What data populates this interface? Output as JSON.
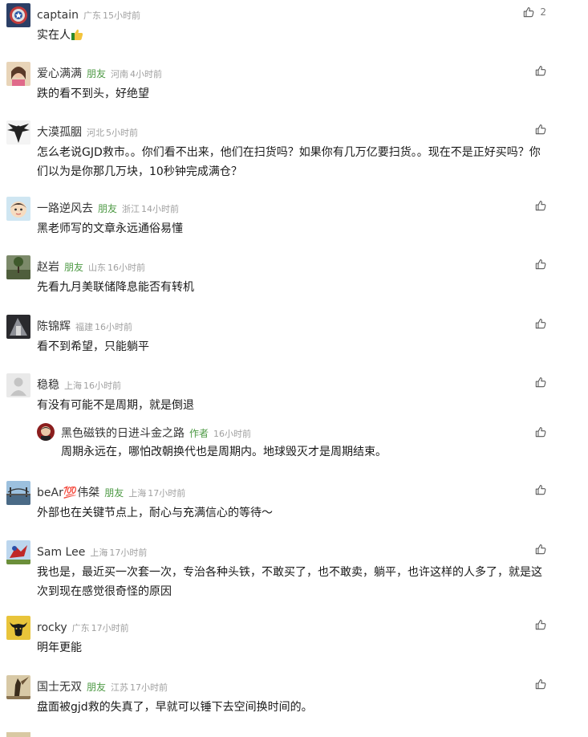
{
  "comments": [
    {
      "name": "captain",
      "friend": "",
      "location": "广东",
      "time": "15小时前",
      "content": "实在人",
      "likes": "2",
      "avatar": "shield-avatar"
    },
    {
      "name": "爱心满满",
      "friend": "朋友",
      "location": "河南",
      "time": "4小时前",
      "content": "跌的看不到头，好绝望",
      "likes": "",
      "avatar": "girl-avatar"
    },
    {
      "name": "大漠孤胭",
      "friend": "",
      "location": "河北",
      "time": "5小时前",
      "content": "怎么老说GJD救市。。你们看不出来，他们在扫货吗？如果你有几万亿要扫货。。现在不是正好买吗？你们以为是你那几万块，10秒钟完成满仓？",
      "likes": "",
      "avatar": "eagle-avatar"
    },
    {
      "name": "一路逆风去",
      "friend": "朋友",
      "location": "浙江",
      "time": "14小时前",
      "content": "黑老师写的文章永远通俗易懂",
      "likes": "",
      "avatar": "cartoon-avatar"
    },
    {
      "name": "赵岩",
      "friend": "朋友",
      "location": "山东",
      "time": "16小时前",
      "content": "先看九月美联储降息能否有转机",
      "likes": "",
      "avatar": "tree-avatar"
    },
    {
      "name": "陈锦辉",
      "friend": "",
      "location": "福建",
      "time": "16小时前",
      "content": "看不到希望，只能躺平",
      "likes": "",
      "avatar": "dark-avatar"
    },
    {
      "name": "稳稳",
      "friend": "",
      "location": "上海",
      "time": "16小时前",
      "content": "有没有可能不是周期，就是倒退",
      "likes": "",
      "avatar": "default-avatar",
      "reply": {
        "name": "黑色磁铁的日进斗金之路",
        "author_tag": "作者",
        "time": "16小时前",
        "content": "周期永远在，哪怕改朝换代也是周期内。地球毁灭才是周期结束。",
        "likes": "",
        "avatar": "magnet-avatar"
      }
    },
    {
      "name": "beAr💯伟桀",
      "friend": "朋友",
      "location": "上海",
      "time": "17小时前",
      "content": "外部也在关键节点上，耐心与充满信心的等待～",
      "likes": "",
      "avatar": "bridge-avatar"
    },
    {
      "name": "Sam Lee",
      "friend": "",
      "location": "上海",
      "time": "17小时前",
      "content": "我也是，最近买一次套一次，专治各种头铁，不敢买了，也不敢卖，躺平，也许这样的人多了，就是这次到现在感觉很奇怪的原因",
      "likes": "",
      "avatar": "hero-avatar"
    },
    {
      "name": "rocky",
      "friend": "",
      "location": "广东",
      "time": "17小时前",
      "content": "明年更能",
      "likes": "",
      "avatar": "bull-avatar"
    },
    {
      "name": "国士无双",
      "friend": "朋友",
      "location": "江苏",
      "time": "17小时前",
      "content": "盘面被gjd救的失真了，早就可以锤下去空间换时间的。",
      "likes": "",
      "avatar": "warrior-avatar"
    }
  ],
  "colors": {
    "friend": "#4e9a45",
    "meta": "#a0a0a0",
    "text": "#1a1a1a"
  }
}
